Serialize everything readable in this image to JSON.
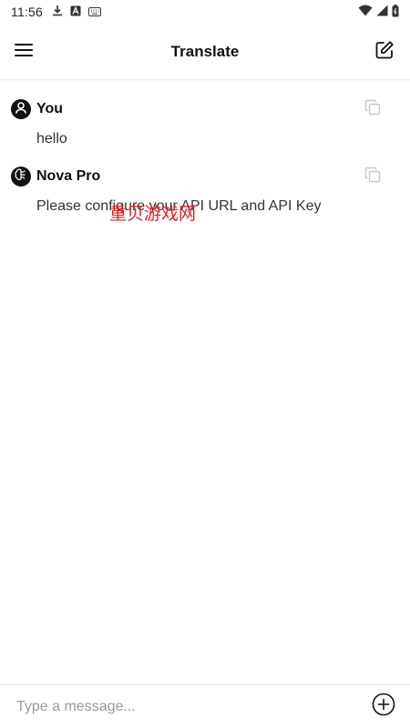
{
  "status_bar": {
    "time": "11:56",
    "left_icons": [
      "download-icon",
      "font-icon",
      "keyboard-icon"
    ],
    "right_icons": [
      "wifi-icon",
      "signal-icon",
      "battery-icon"
    ]
  },
  "app_bar": {
    "title": "Translate",
    "menu_icon": "menu-icon",
    "edit_icon": "edit-icon"
  },
  "messages": [
    {
      "sender": "You",
      "text": "hello",
      "avatar_icon": "user-icon",
      "copy_icon": "copy-icon"
    },
    {
      "sender": "Nova Pro",
      "text": "Please configure your API URL and API Key",
      "avatar_icon": "brain-icon",
      "copy_icon": "copy-icon"
    }
  ],
  "watermark": "重贝游戏网",
  "input": {
    "placeholder": "Type a message...",
    "value": "",
    "add_icon": "add-circle-icon"
  },
  "colors": {
    "background": "#ffffff",
    "text_primary": "#111111",
    "text_secondary": "#333333",
    "icon_muted": "#c8c8c8",
    "watermark": "#e02424"
  }
}
